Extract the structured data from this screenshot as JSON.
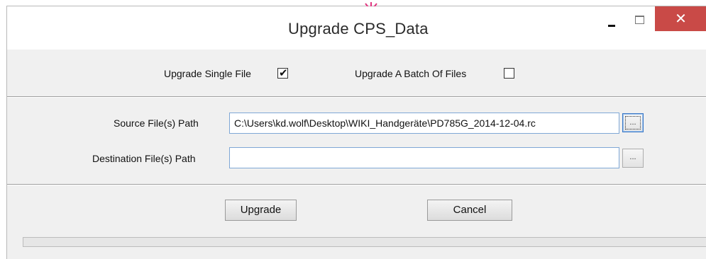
{
  "window": {
    "title": "Upgrade CPS_Data",
    "controls": {
      "minimize_icon": "minimize-icon",
      "maximize_icon": "maximize-icon",
      "close_icon": "close-icon",
      "close_color": "#c94a47"
    },
    "annotation_arrow_color": "#e0357f"
  },
  "mode": {
    "single_label": "Upgrade Single File",
    "single_checked": true,
    "batch_label": "Upgrade A Batch Of Files",
    "batch_checked": false
  },
  "paths": {
    "source_label": "Source File(s) Path",
    "source_value": "C:\\Users\\kd.wolf\\Desktop\\WIKI_Handgeräte\\PD785G_2014-12-04.rc",
    "source_browse": "...",
    "dest_label": "Destination File(s) Path",
    "dest_value": "",
    "dest_browse": "..."
  },
  "actions": {
    "upgrade_label": "Upgrade",
    "cancel_label": "Cancel"
  },
  "progress": {
    "value_percent": 0
  }
}
